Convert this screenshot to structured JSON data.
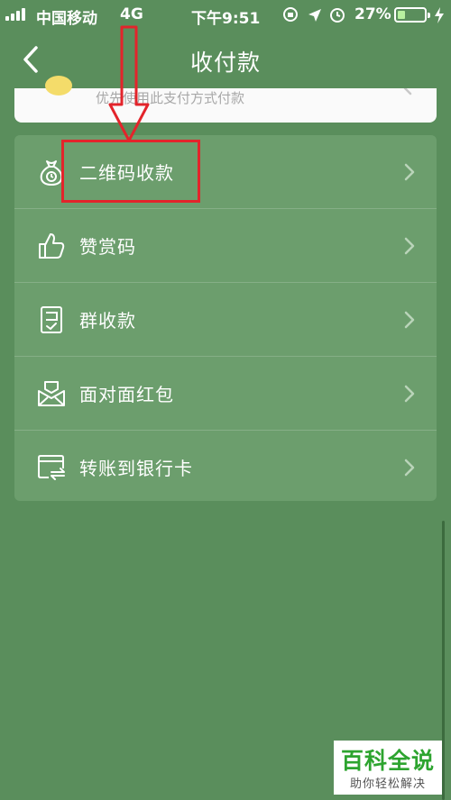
{
  "status_bar": {
    "carrier": "中国移动",
    "network": "4G",
    "time": "下午9:51",
    "battery_percent": "27%",
    "battery_level": 0.27
  },
  "nav": {
    "title": "收付款",
    "back_icon": "chevron-left-icon"
  },
  "top_card": {
    "text": "优先使用此支付方式付款"
  },
  "menu": {
    "items": [
      {
        "label": "二维码收款",
        "icon": "money-bag-icon"
      },
      {
        "label": "赞赏码",
        "icon": "thumbs-up-icon"
      },
      {
        "label": "群收款",
        "icon": "group-bill-icon"
      },
      {
        "label": "面对面红包",
        "icon": "red-packet-icon"
      },
      {
        "label": "转账到银行卡",
        "icon": "bank-card-transfer-icon"
      }
    ]
  },
  "watermark": {
    "title": "百科全说",
    "subtitle": "助你轻松解决"
  },
  "colors": {
    "background": "#5a8e5c",
    "list_background": "#6c9e6d",
    "annotation_red": "#e3242b",
    "watermark_green": "#2da42f"
  }
}
